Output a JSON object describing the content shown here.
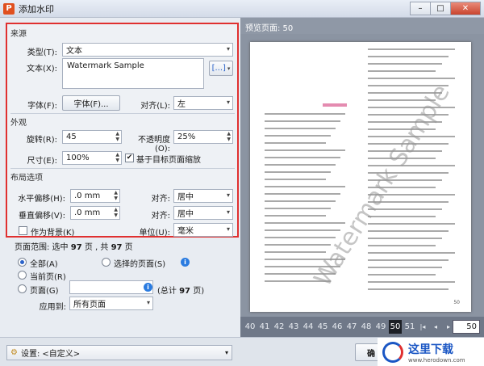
{
  "window": {
    "title": "添加水印",
    "app_icon": "P",
    "min": "–",
    "max": "□",
    "close": "✕"
  },
  "source": {
    "section": "来源",
    "type_label": "类型(T):",
    "type_value": "文本",
    "text_label": "文本(X):",
    "text_value": "Watermark Sample",
    "insert_btn": "[...]",
    "font_label": "字体(F):",
    "font_btn": "字体(F)...",
    "align_label": "对齐(L):",
    "align_value": "左"
  },
  "appearance": {
    "section": "外观",
    "rotation_label": "旋转(R):",
    "rotation_value": "45",
    "opacity_label": "不透明度(O):",
    "opacity_value": "25%",
    "size_label": "尺寸(E):",
    "size_value": "100%",
    "scale_check": "基于目标页面缩放"
  },
  "layout": {
    "section": "布局选项",
    "hoffset_label": "水平偏移(H):",
    "hoffset_value": ".0 mm",
    "voffset_label": "垂直偏移(V):",
    "voffset_value": ".0 mm",
    "halign_label": "对齐:",
    "halign_value": "居中",
    "valign_label": "对齐:",
    "valign_value": "居中",
    "background_check": "作为背景(K)",
    "unit_label": "单位(U):",
    "unit_value": "毫米"
  },
  "range": {
    "summary_prefix": "页面范围: 选中 ",
    "selected": "97",
    "summary_mid": " 页 , 共 ",
    "total": "97",
    "summary_suffix": " 页",
    "all_label": "全部(A)",
    "selected_label": "选择的页面(S)",
    "current_label": "当前页(R)",
    "pages_label": "页面(G)",
    "total_prefix": "(总计 ",
    "total_count": "97",
    "total_suffix": " 页)",
    "apply_label": "应用到:",
    "apply_value": "所有页面"
  },
  "footer": {
    "settings_label": "设置:",
    "settings_value": "<自定义>",
    "ok_label": "确"
  },
  "preview": {
    "header": "预览页面: 50",
    "watermark": "Watermark Sample",
    "page_number": "50",
    "current_page": "50",
    "pages": [
      "40",
      "41",
      "42",
      "43",
      "44",
      "45",
      "46",
      "47",
      "48",
      "49",
      "50",
      "51"
    ],
    "nav": [
      "|◂",
      "◂",
      "▸",
      "▸|"
    ]
  },
  "logo": {
    "text": "这里下载",
    "url": "www.herodown.com"
  },
  "colors": {
    "highlight": "#e03030",
    "accent": "#2a7be0"
  }
}
